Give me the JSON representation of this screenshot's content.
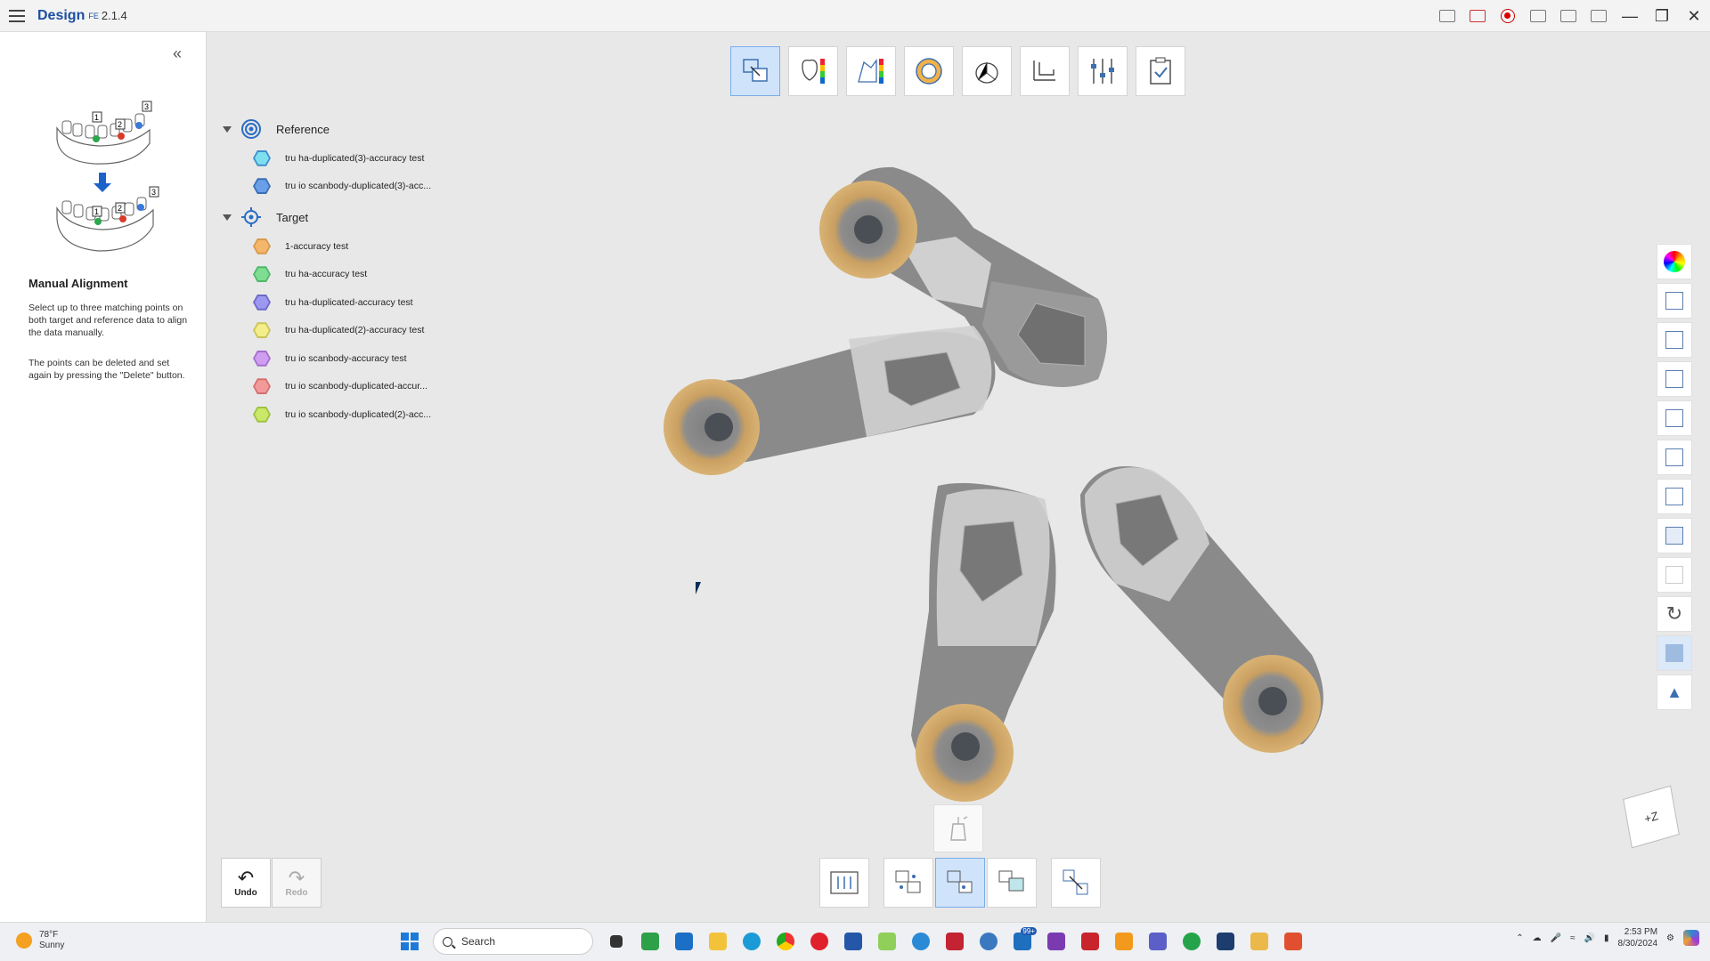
{
  "app": {
    "title": "Design",
    "superscript": "FE",
    "version": "2.1.4"
  },
  "left_panel": {
    "collapse_glyph": "«",
    "heading": "Manual Alignment",
    "description": "Select up to three matching points on both target and reference data to align the data manually.",
    "description2": "The points can be deleted and set again by pressing the \"Delete\" button.",
    "illustration_labels": [
      "1",
      "2",
      "3",
      "1",
      "2",
      "3"
    ]
  },
  "tree": {
    "reference": {
      "label": "Reference",
      "items": [
        {
          "label": "tru ha-duplicated(3)-accuracy test",
          "color": "#7ee0ef"
        },
        {
          "label": "tru io scanbody-duplicated(3)-acc...",
          "color": "#6b9ee8"
        }
      ]
    },
    "target": {
      "label": "Target",
      "items": [
        {
          "label": "1-accuracy test",
          "color": "#f3b66a"
        },
        {
          "label": "tru ha-accuracy test",
          "color": "#7fdc93"
        },
        {
          "label": "tru ha-duplicated-accuracy test",
          "color": "#9c98ef"
        },
        {
          "label": "tru ha-duplicated(2)-accuracy test",
          "color": "#f4ee8a"
        },
        {
          "label": "tru io scanbody-accuracy test",
          "color": "#cf9ef0"
        },
        {
          "label": "tru io scanbody-duplicated-accur...",
          "color": "#f29a9a"
        },
        {
          "label": "tru io scanbody-duplicated(2)-acc...",
          "color": "#cbe86a"
        }
      ]
    }
  },
  "top_tools": [
    "alignment-tool",
    "color-map-tool",
    "deviation-tool",
    "model-tool",
    "axis-tool",
    "measure-tool",
    "settings-tool",
    "report-tool"
  ],
  "bottom": {
    "undo_label": "Undo",
    "redo_label": "Redo"
  },
  "navcube_label": "+Z",
  "taskbar": {
    "weather_temp": "78°F",
    "weather_text": "Sunny",
    "search_placeholder": "Search",
    "notif_badge": "99+",
    "time": "2:53 PM",
    "date": "8/30/2024"
  },
  "colors": {
    "accent": "#1c4fa0",
    "active_tool": "#cfe3fb"
  }
}
